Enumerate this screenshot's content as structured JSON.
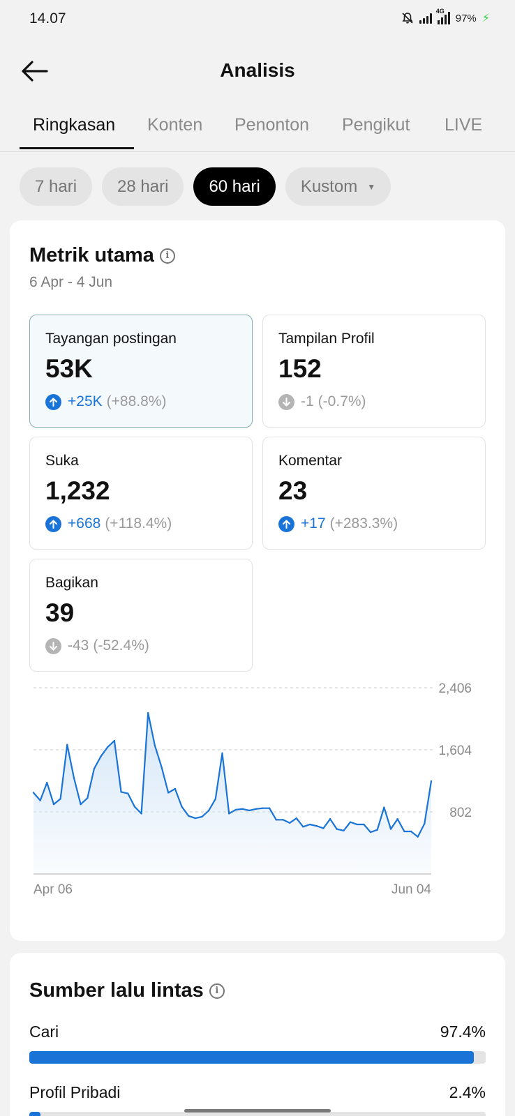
{
  "status_bar": {
    "time": "14.07",
    "battery": "97%",
    "network": "4G"
  },
  "header": {
    "title": "Analisis",
    "back_icon": "arrow-left-icon"
  },
  "tabs": [
    {
      "label": "Ringkasan",
      "active": true
    },
    {
      "label": "Konten",
      "active": false
    },
    {
      "label": "Penonton",
      "active": false
    },
    {
      "label": "Pengikut",
      "active": false
    },
    {
      "label": "LIVE",
      "active": false
    }
  ],
  "filters": [
    {
      "label": "7 hari",
      "active": false
    },
    {
      "label": "28 hari",
      "active": false
    },
    {
      "label": "60 hari",
      "active": true
    },
    {
      "label": "Kustom",
      "active": false
    }
  ],
  "metrics_section": {
    "title": "Metrik utama",
    "date_range": "6 Apr - 4 Jun",
    "metrics": [
      {
        "label": "Tayangan postingan",
        "value": "53K",
        "delta": "+25K",
        "pct": "(+88.8%)",
        "trend": "up",
        "selected": true
      },
      {
        "label": "Tampilan Profil",
        "value": "152",
        "delta": "-1",
        "pct": "(-0.7%)",
        "trend": "down",
        "selected": false
      },
      {
        "label": "Suka",
        "value": "1,232",
        "delta": "+668",
        "pct": "(+118.4%)",
        "trend": "up",
        "selected": false
      },
      {
        "label": "Komentar",
        "value": "23",
        "delta": "+17",
        "pct": "(+283.3%)",
        "trend": "up",
        "selected": false
      },
      {
        "label": "Bagikan",
        "value": "39",
        "delta": "-43",
        "pct": "(-52.4%)",
        "trend": "down",
        "selected": false
      }
    ]
  },
  "chart_data": {
    "type": "area",
    "title": "",
    "xlabel": "",
    "ylabel": "",
    "x_tick_labels": [
      "Apr 06",
      "Jun 04"
    ],
    "y_ticks": [
      802,
      1604,
      2406
    ],
    "y_tick_labels": [
      "802",
      "1,604",
      "2,406"
    ],
    "ylim": [
      0,
      2406
    ],
    "grid": true,
    "series": [
      {
        "values": [
          1050,
          950,
          1180,
          900,
          970,
          1670,
          1240,
          900,
          980,
          1360,
          1520,
          1640,
          1720,
          1060,
          1040,
          870,
          780,
          2080,
          1660,
          1380,
          1050,
          1100,
          870,
          750,
          720,
          740,
          820,
          970,
          1560,
          780,
          830,
          840,
          820,
          840,
          850,
          850,
          700,
          700,
          660,
          720,
          610,
          640,
          620,
          590,
          710,
          580,
          560,
          670,
          640,
          640,
          540,
          570,
          860,
          580,
          710,
          550,
          550,
          480,
          650,
          1200
        ]
      }
    ],
    "color": "#1a74d8"
  },
  "traffic_section": {
    "title": "Sumber lalu lintas",
    "sources": [
      {
        "label": "Cari",
        "pct": "97.4%",
        "value": 97.4
      },
      {
        "label": "Profil Pribadi",
        "pct": "2.4%",
        "value": 2.4
      }
    ]
  }
}
